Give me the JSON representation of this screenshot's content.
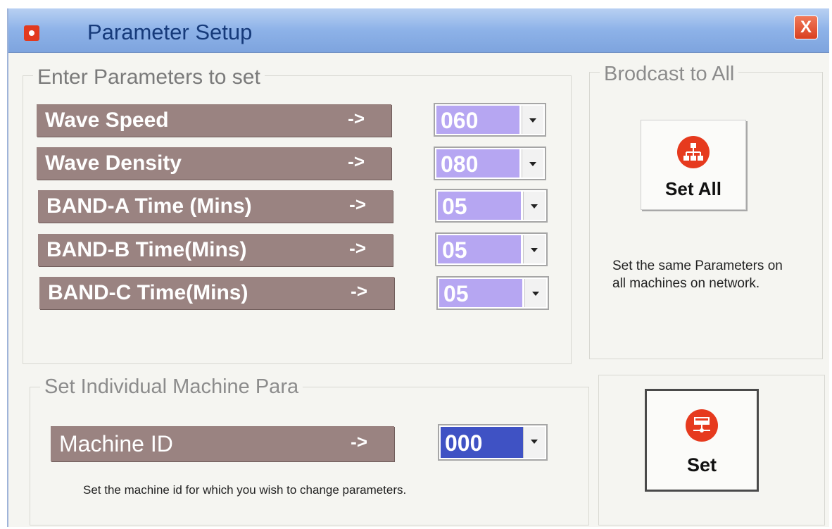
{
  "window": {
    "title": "Parameter Setup",
    "close_label": "X"
  },
  "params_group": {
    "legend": "Enter Parameters to set",
    "rows": [
      {
        "label": "Wave Speed",
        "arrow": "->",
        "value": "060"
      },
      {
        "label": "Wave Density",
        "arrow": "->",
        "value": "080"
      },
      {
        "label": "BAND-A Time (Mins)",
        "arrow": "->",
        "value": "05"
      },
      {
        "label": "BAND-B Time(Mins)",
        "arrow": "->",
        "value": "05"
      },
      {
        "label": "BAND-C Time(Mins)",
        "arrow": "->",
        "value": "05"
      }
    ]
  },
  "broadcast_group": {
    "legend": "Brodcast to All",
    "button_label": "Set All",
    "description_line1": "Set the same Parameters on",
    "description_line2": "all machines on network."
  },
  "individual_group": {
    "legend": "Set Individual Machine Para",
    "machine_label": "Machine ID",
    "arrow": "->",
    "machine_value": "000",
    "description": "Set the machine id for which you wish to change parameters."
  },
  "set_button": {
    "label": "Set"
  },
  "colors": {
    "label_bg": "#9a8381",
    "combo_bg": "#b6a6f2",
    "machine_combo_bg": "#3f52c4",
    "accent_icon": "#e63a1e",
    "title_bar": "#8db2e8"
  },
  "icons": {
    "app": "app-gear-icon",
    "set_all": "network-broadcast-icon",
    "set": "single-machine-icon",
    "close": "close-icon",
    "dropdown": "chevron-down-icon"
  }
}
